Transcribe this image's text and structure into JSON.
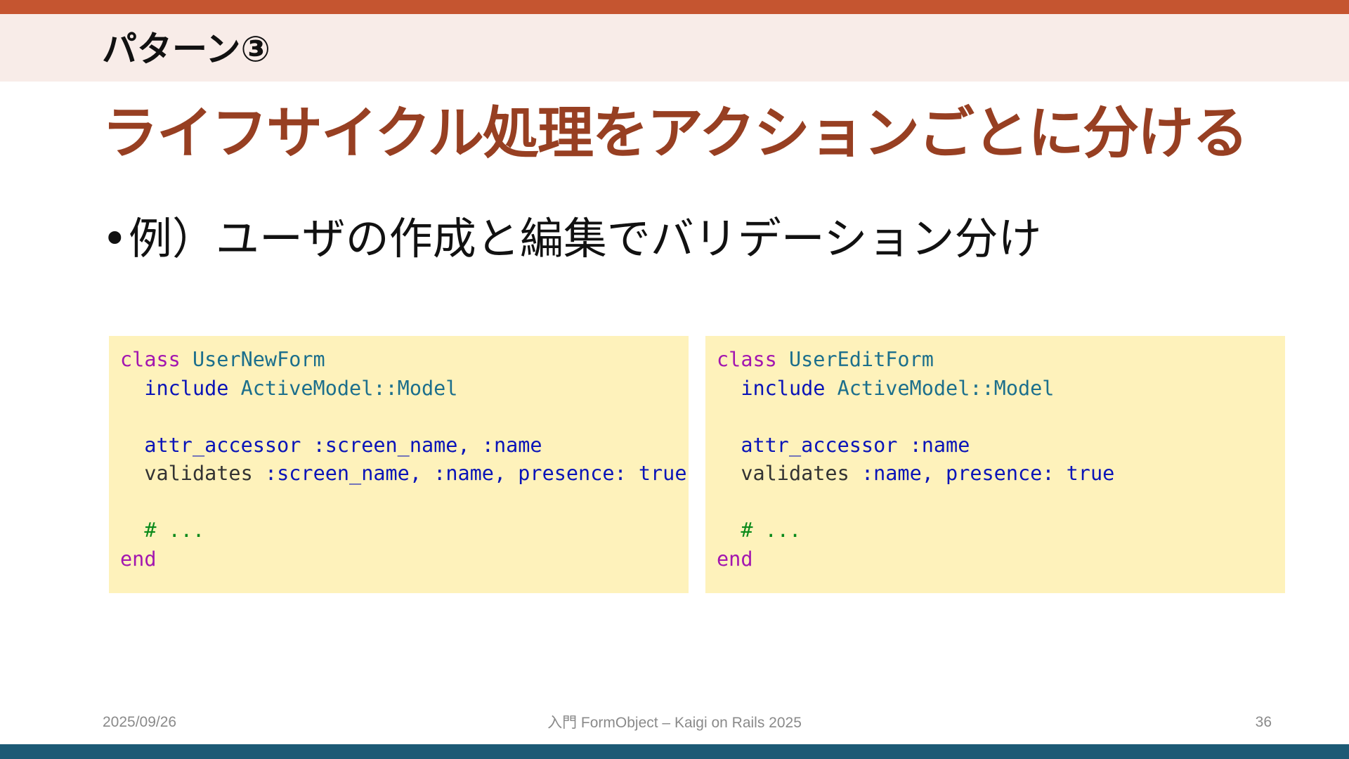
{
  "header": {
    "section_label": "パターン③",
    "title": "ライフサイクル処理をアクションごとに分ける"
  },
  "bullet": {
    "marker": "•",
    "text": "例）ユーザの作成と編集でバリデーション分け"
  },
  "code_left": {
    "line1": {
      "kw": "class",
      "name": "UserNewForm"
    },
    "line2": {
      "kw": "include",
      "const": "ActiveModel::Model"
    },
    "line3": {
      "method": "attr_accessor",
      "args": ":screen_name, :name"
    },
    "line4": {
      "method": "validates",
      "args": ":screen_name, :name, presence: true"
    },
    "line5": {
      "comment": "# ..."
    },
    "line6": {
      "kw": "end"
    }
  },
  "code_right": {
    "line1": {
      "kw": "class",
      "name": "UserEditForm"
    },
    "line2": {
      "kw": "include",
      "const": "ActiveModel::Model"
    },
    "line3": {
      "method": "attr_accessor",
      "args": ":name"
    },
    "line4": {
      "method": "validates",
      "args": ":name, presence: true"
    },
    "line5": {
      "comment": "# ..."
    },
    "line6": {
      "kw": "end"
    }
  },
  "footer": {
    "date": "2025/09/26",
    "center": "入門 FormObject – Kaigi on Rails 2025",
    "page_number": "36"
  },
  "colors": {
    "accent_top": "#c55530",
    "accent_bottom": "#1c5a75",
    "title": "#973f22",
    "code_bg": "#fef2bb"
  }
}
